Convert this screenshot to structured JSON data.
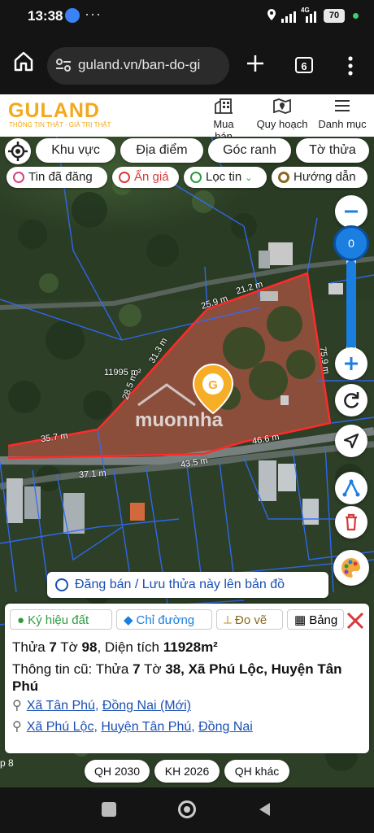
{
  "status_bar": {
    "time": "13:38",
    "network": "4G",
    "battery": "70"
  },
  "browser": {
    "url": "guland.vn/ban-do-gi",
    "tab_count": "6"
  },
  "header": {
    "logo": "GULAND",
    "tagline": "THÔNG TIN THẬT · GIÁ TRỊ THẬT",
    "nav": [
      {
        "label": "Mua bán",
        "icon": "building-icon"
      },
      {
        "label": "Quy hoạch",
        "icon": "map-pin-icon"
      },
      {
        "label": "Danh mục",
        "icon": "menu-icon"
      }
    ]
  },
  "toolbar": {
    "chips": [
      "Khu vực",
      "Địa điểm",
      "Góc ranh",
      "Tờ thửa"
    ],
    "chips2": [
      {
        "label": "Tin đã đăng",
        "color": "#d8437a"
      },
      {
        "label": "Ẩn giá",
        "color": "#d83a3a"
      },
      {
        "label": "Lọc tin",
        "color": "#2e9a3e"
      },
      {
        "label": "Hướng dẫn",
        "color": "#8a6a1c"
      }
    ]
  },
  "map": {
    "zoom_value": "0",
    "area_label": "11995 m²",
    "watermark": "muonnha",
    "measurements": [
      "25.9 m",
      "21.2 m",
      "31.3 m",
      "28.5 m",
      "75.9 m",
      "35.7 m",
      "46.6 m",
      "43.5 m",
      "37.1 m"
    ],
    "corner_text": "p 8"
  },
  "banner": {
    "text": "Đăng bán / Lưu thửa này lên bản đồ"
  },
  "panel": {
    "tabs": [
      "Ký hiệu đất",
      "Chỉ đường",
      "Đo vẽ",
      "Bảng"
    ],
    "parcel": {
      "prefix": "Thửa ",
      "thua": "7",
      "mid": " Tờ ",
      "to": "98",
      "area_prefix": ", Diện tích ",
      "area": "11928m²"
    },
    "old_info": {
      "prefix": "Thông tin cũ: Thửa ",
      "thua": "7",
      "mid": " Tờ ",
      "to": "38",
      "location": ", Xã Phú Lộc, Huyện Tân Phú"
    },
    "loc1": {
      "a": "Xã Tân Phú",
      "b": "Đồng Nai (Mới)"
    },
    "loc2": {
      "a": "Xã Phú Lộc",
      "b": "Huyện Tân Phú",
      "c": "Đồng Nai"
    }
  },
  "bottom_chips": [
    "QH 2030",
    "KH 2026",
    "QH khác"
  ],
  "colors": {
    "accent": "#f2a91c",
    "link": "#1a4fb4",
    "zoom": "#1a7fe0",
    "parcel_border": "#ff2a2a"
  }
}
